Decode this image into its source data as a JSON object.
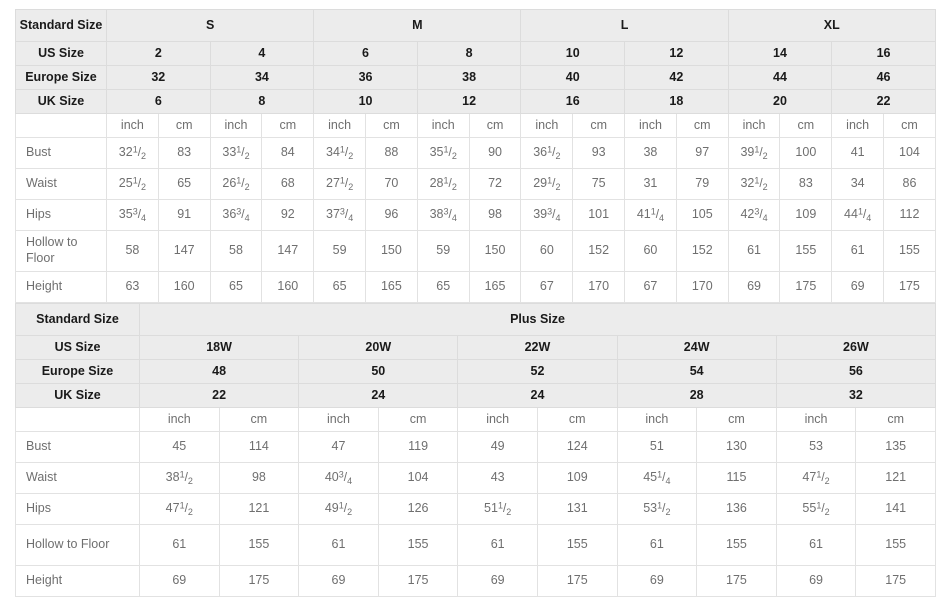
{
  "standard": {
    "corner_label": "Standard Size",
    "row_labels": {
      "us": "US Size",
      "eu": "Europe Size",
      "uk": "UK Size",
      "bust": "Bust",
      "waist": "Waist",
      "hips": "Hips",
      "hollow": "Hollow to Floor",
      "height": "Height"
    },
    "units": {
      "inch": "inch",
      "cm": "cm"
    },
    "size_groups": [
      {
        "label": "S",
        "span": 2
      },
      {
        "label": "M",
        "span": 2
      },
      {
        "label": "L",
        "span": 2
      },
      {
        "label": "XL",
        "span": 2
      }
    ],
    "us_sizes": [
      "2",
      "4",
      "6",
      "8",
      "10",
      "12",
      "14",
      "16"
    ],
    "eu_sizes": [
      "32",
      "34",
      "36",
      "38",
      "40",
      "42",
      "44",
      "46"
    ],
    "uk_sizes": [
      "6",
      "8",
      "10",
      "12",
      "16",
      "18",
      "20",
      "22"
    ],
    "measurements": [
      {
        "label": "Bust",
        "inch": [
          "32 1/2",
          "33 1/2",
          "34 1/2",
          "35 1/2",
          "36 1/2",
          "38",
          "39 1/2",
          "41"
        ],
        "cm": [
          "83",
          "84",
          "88",
          "90",
          "93",
          "97",
          "100",
          "104"
        ]
      },
      {
        "label": "Waist",
        "inch": [
          "25 1/2",
          "26 1/2",
          "27 1/2",
          "28 1/2",
          "29 1/2",
          "31",
          "32 1/2",
          "34"
        ],
        "cm": [
          "65",
          "68",
          "70",
          "72",
          "75",
          "79",
          "83",
          "86"
        ]
      },
      {
        "label": "Hips",
        "inch": [
          "35 3/4",
          "36 3/4",
          "37 3/4",
          "38 3/4",
          "39 3/4",
          "41 1/4",
          "42 3/4",
          "44 1/4"
        ],
        "cm": [
          "91",
          "92",
          "96",
          "98",
          "101",
          "105",
          "109",
          "112"
        ]
      },
      {
        "label": "Hollow to Floor",
        "inch": [
          "58",
          "58",
          "59",
          "59",
          "60",
          "60",
          "61",
          "61"
        ],
        "cm": [
          "147",
          "147",
          "150",
          "150",
          "152",
          "152",
          "155",
          "155"
        ]
      },
      {
        "label": "Height",
        "inch": [
          "63",
          "65",
          "65",
          "65",
          "67",
          "67",
          "69",
          "69"
        ],
        "cm": [
          "160",
          "160",
          "165",
          "165",
          "170",
          "170",
          "175",
          "175"
        ]
      }
    ]
  },
  "plus": {
    "corner_label": "Standard Size",
    "title": "Plus Size",
    "row_labels": {
      "us": "US Size",
      "eu": "Europe Size",
      "uk": "UK Size"
    },
    "units": {
      "inch": "inch",
      "cm": "cm"
    },
    "us_sizes": [
      "18W",
      "20W",
      "22W",
      "24W",
      "26W"
    ],
    "eu_sizes": [
      "48",
      "50",
      "52",
      "54",
      "56"
    ],
    "uk_sizes": [
      "22",
      "24",
      "24",
      "28",
      "32"
    ],
    "measurements": [
      {
        "label": "Bust",
        "inch": [
          "45",
          "47",
          "49",
          "51",
          "53"
        ],
        "cm": [
          "114",
          "119",
          "124",
          "130",
          "135"
        ]
      },
      {
        "label": "Waist",
        "inch": [
          "38 1/2",
          "40 3/4",
          "43",
          "45 1/4",
          "47 1/2"
        ],
        "cm": [
          "98",
          "104",
          "109",
          "115",
          "121"
        ]
      },
      {
        "label": "Hips",
        "inch": [
          "47 1/2",
          "49 1/2",
          "51 1/2",
          "53 1/2",
          "55 1/2"
        ],
        "cm": [
          "121",
          "126",
          "131",
          "136",
          "141"
        ]
      },
      {
        "label": "Hollow to Floor",
        "inch": [
          "61",
          "61",
          "61",
          "61",
          "61"
        ],
        "cm": [
          "155",
          "155",
          "155",
          "155",
          "155"
        ]
      },
      {
        "label": "Height",
        "inch": [
          "69",
          "69",
          "69",
          "69",
          "69"
        ],
        "cm": [
          "175",
          "175",
          "175",
          "175",
          "175"
        ]
      }
    ]
  },
  "colors": {
    "header_bg": "#ececec",
    "grid": "#e2e2e2",
    "text_dark": "#1a1a1a",
    "text_light": "#6f6f6f"
  }
}
